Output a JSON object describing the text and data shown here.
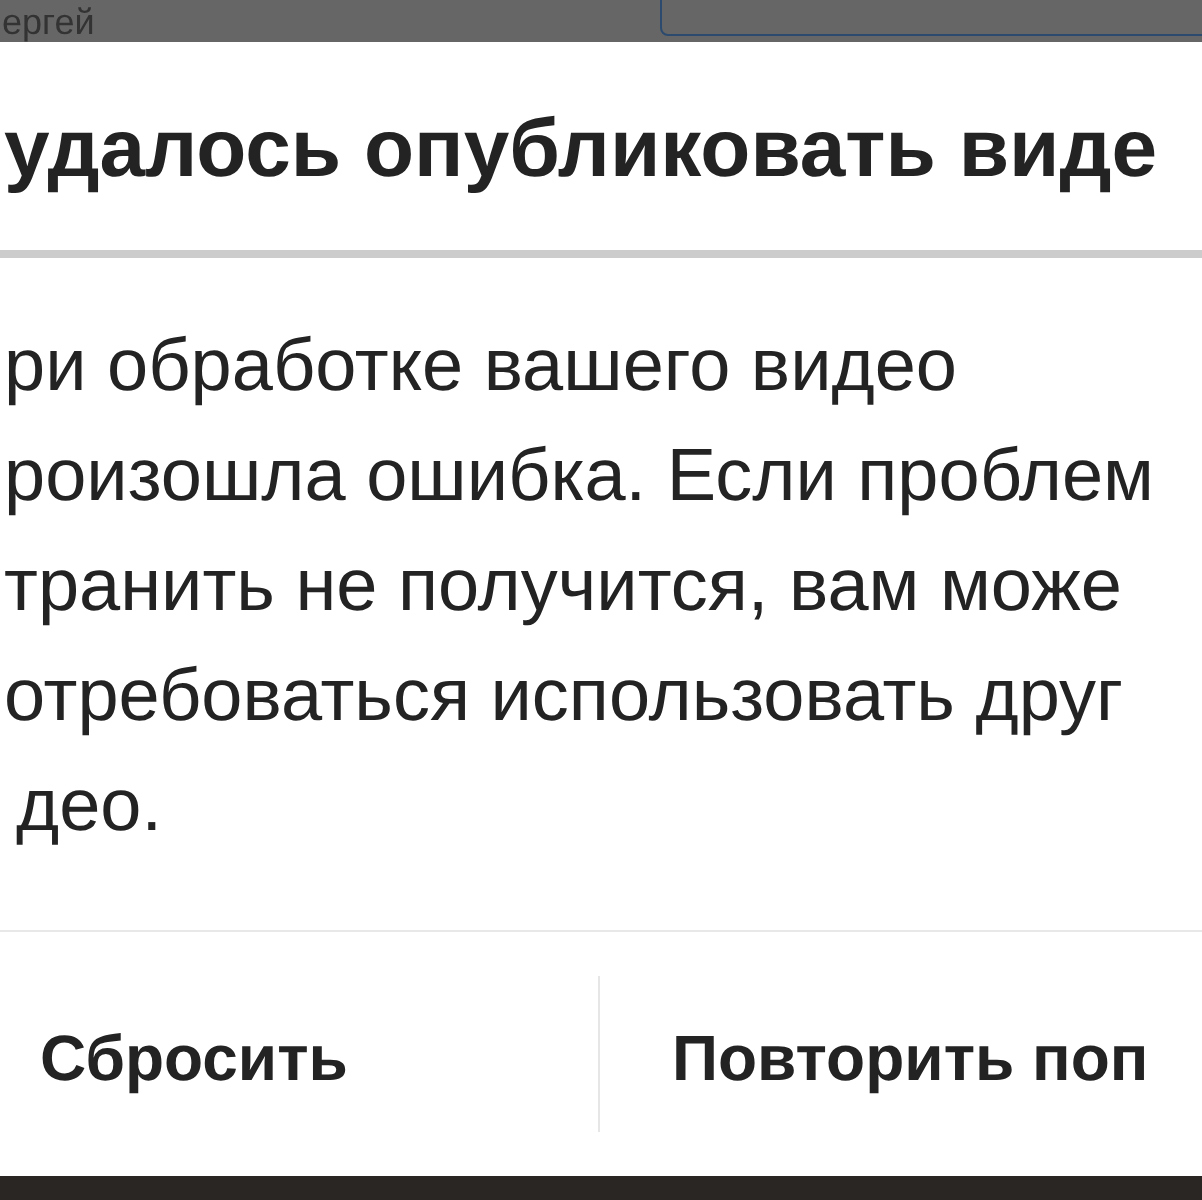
{
  "background": {
    "author": "ергей"
  },
  "dialog": {
    "title": "удалось опубликовать виде",
    "message_lines": [
      "ри обработке вашего видео",
      "роизошла ошибка. Если проблем",
      "транить не получится, вам може",
      "отребоваться использовать друг",
      "део."
    ],
    "buttons": [
      "Сбросить",
      "Повторить поп"
    ]
  }
}
